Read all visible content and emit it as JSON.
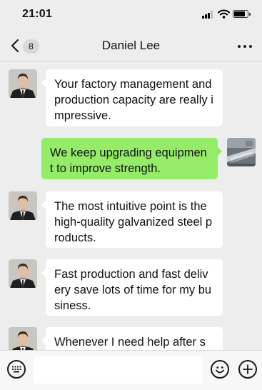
{
  "status_bar": {
    "time": "21:01"
  },
  "nav": {
    "unread_count": "8",
    "contact_name": "Daniel Lee"
  },
  "messages": [
    {
      "from": "contact",
      "text": "Your factory management and production capacity are really impressive."
    },
    {
      "from": "me",
      "text": "We keep upgrading equipment to improve strength."
    },
    {
      "from": "contact",
      "text": "The most intuitive point is the high-quality galvanized steel products."
    },
    {
      "from": "contact",
      "text": "Fast production and fast delivery save lots of time for my business."
    },
    {
      "from": "contact",
      "text": "Whenever I need help after s"
    }
  ],
  "input_bar": {
    "placeholder": ""
  },
  "icons": [
    "back-arrow-icon",
    "more-icon",
    "keyboard-icon",
    "emoji-icon",
    "plus-icon"
  ],
  "colors": {
    "background": "#ededed",
    "incoming_bubble": "#ffffff",
    "outgoing_bubble": "#95ec69"
  }
}
